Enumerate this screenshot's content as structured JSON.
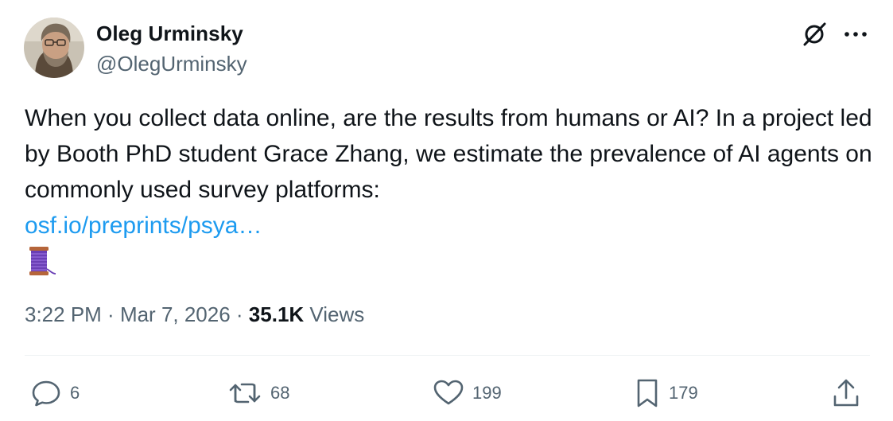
{
  "author": {
    "display_name": "Oleg Urminsky",
    "handle": "@OlegUrminsky",
    "avatar_icon": "user-avatar"
  },
  "header_icons": [
    "grok-icon",
    "more-icon"
  ],
  "tweet": {
    "text": "When you collect data online, are the results from humans or AI? In a project led by Booth PhD student Grace Zhang, we estimate the prevalence of AI agents on commonly used survey platforms:",
    "link": "osf.io/preprints/psya…",
    "emoji": "spool-of-thread-emoji"
  },
  "meta": {
    "time": "3:22 PM",
    "sep1": " · ",
    "date": "Mar 7, 2026",
    "sep2": " · ",
    "views_count": "35.1K",
    "views_label": " Views"
  },
  "actions": {
    "replies": "6",
    "reposts": "68",
    "likes": "199",
    "bookmarks": "179"
  },
  "colors": {
    "text": "#0f1419",
    "secondary": "#536471",
    "link": "#1d9bf0",
    "divider": "#eff3f4"
  }
}
